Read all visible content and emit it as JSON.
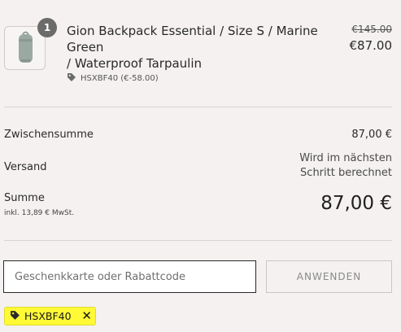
{
  "cart": {
    "item": {
      "quantity": "1",
      "title_line1": "Gion Backpack Essential / Size S / Marine Green",
      "title_line2": "/ Waterproof Tarpaulin",
      "original_price": "€145.00",
      "sale_price": "€87.00",
      "discount_tag": "HSXBF40 (€-58.00)"
    }
  },
  "summary": {
    "subtotal_label": "Zwischensumme",
    "subtotal_value": "87,00 €",
    "shipping_label": "Versand",
    "shipping_value_line1": "Wird im nächsten",
    "shipping_value_line2": "Schritt berechnet",
    "total_label": "Summe",
    "tax_note": "inkl. 13,89 € MwSt.",
    "total_value": "87,00 €"
  },
  "discount": {
    "input_placeholder": "Geschenkkarte oder Rabattcode",
    "apply_label": "ANWENDEN",
    "applied_code": "HSXBF40",
    "remove_symbol": "✕"
  },
  "colors": {
    "product_green": "#9aaaa3",
    "chip_highlight": "#fff936",
    "background": "#f4f1f0"
  }
}
